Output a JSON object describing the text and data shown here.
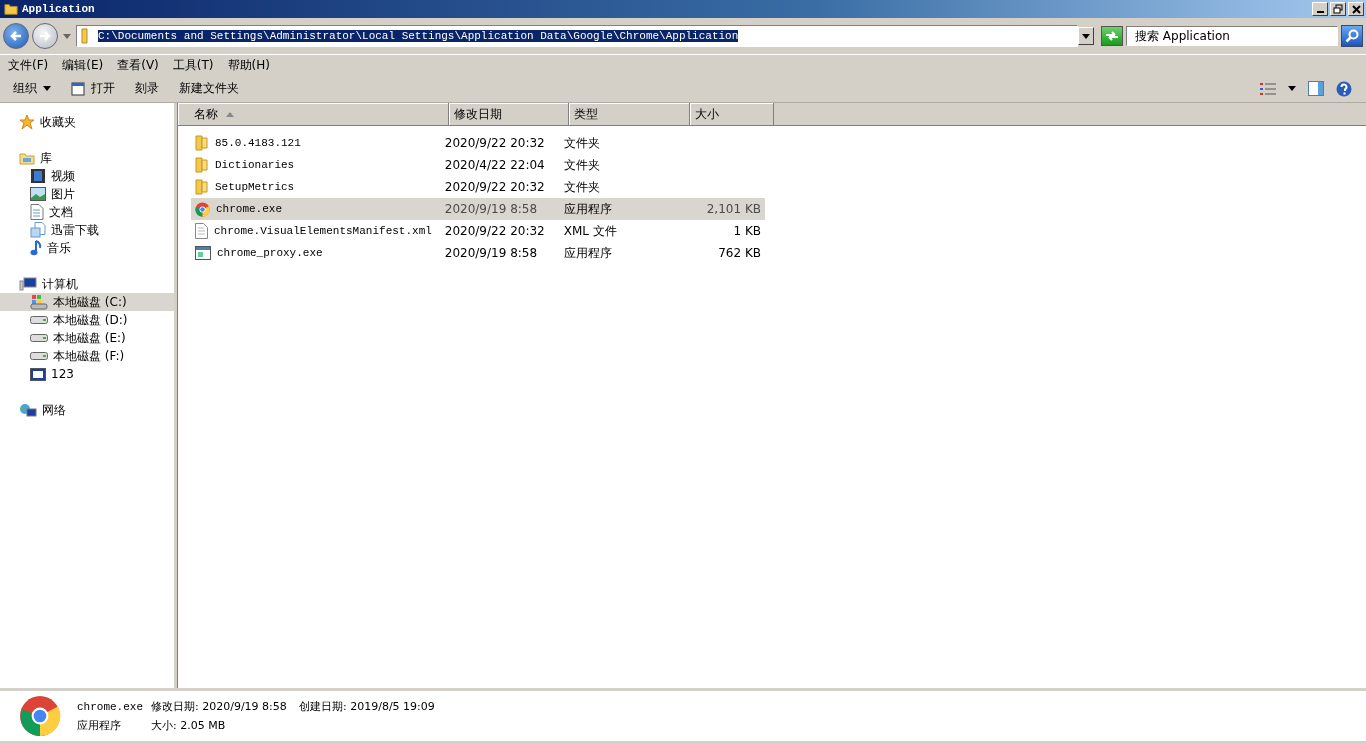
{
  "window": {
    "title": "Application"
  },
  "address": {
    "value": "C:\\Documents and Settings\\Administrator\\Local Settings\\Application Data\\Google\\Chrome\\Application"
  },
  "search": {
    "placeholder": "搜索 Application"
  },
  "menu": [
    "文件(F)",
    "编辑(E)",
    "查看(V)",
    "工具(T)",
    "帮助(H)"
  ],
  "toolbar": [
    {
      "label": "组织",
      "kind": "dropdown"
    },
    {
      "label": "打开",
      "kind": "open"
    },
    {
      "label": "刻录",
      "kind": "plain"
    },
    {
      "label": "新建文件夹",
      "kind": "plain"
    }
  ],
  "sidebar": {
    "groups": [
      {
        "label": "收藏夹",
        "kind": "star",
        "selected": false
      },
      {
        "label": "库",
        "kind": "library",
        "selected": false,
        "children": [
          {
            "label": "视频",
            "kind": "video",
            "selected": false
          },
          {
            "label": "图片",
            "kind": "picture",
            "selected": false
          },
          {
            "label": "文档",
            "kind": "document",
            "selected": false
          },
          {
            "label": "迅雷下载",
            "kind": "download",
            "selected": false
          },
          {
            "label": "音乐",
            "kind": "music",
            "selected": false
          }
        ]
      },
      {
        "label": "计算机",
        "kind": "computer",
        "selected": false,
        "children": [
          {
            "label": "本地磁盘 (C:)",
            "kind": "system-drive",
            "selected": true
          },
          {
            "label": "本地磁盘 (D:)",
            "kind": "drive",
            "selected": false
          },
          {
            "label": "本地磁盘 (E:)",
            "kind": "drive",
            "selected": false
          },
          {
            "label": "本地磁盘 (F:)",
            "kind": "drive",
            "selected": false
          },
          {
            "label": "123",
            "kind": "media",
            "selected": false
          }
        ]
      },
      {
        "label": "网络",
        "kind": "network",
        "selected": false
      }
    ]
  },
  "table": {
    "columns": [
      {
        "label": "名称",
        "sorted": true
      },
      {
        "label": "修改日期",
        "sorted": false
      },
      {
        "label": "类型",
        "sorted": false
      },
      {
        "label": "大小",
        "sorted": false
      }
    ],
    "rows": [
      {
        "name": "85.0.4183.121",
        "date": "2020/9/22 20:32",
        "type": "文件夹",
        "kind": "folder",
        "selected": false
      },
      {
        "name": "Dictionaries",
        "date": "2020/4/22 22:04",
        "type": "文件夹",
        "kind": "folder",
        "selected": false
      },
      {
        "name": "SetupMetrics",
        "date": "2020/9/22 20:32",
        "type": "文件夹",
        "kind": "folder",
        "selected": false
      },
      {
        "name": "chrome.exe",
        "date": "2020/9/19 8:58",
        "type": "应用程序",
        "size": "2,101 KB",
        "kind": "chrome",
        "selected": true
      },
      {
        "name": "chrome.VisualElementsManifest.xml",
        "date": "2020/9/22 20:32",
        "type": "XML 文件",
        "size": "1 KB",
        "kind": "document",
        "selected": false
      },
      {
        "name": "chrome_proxy.exe",
        "date": "2020/9/19 8:58",
        "type": "应用程序",
        "size": "762 KB",
        "kind": "program",
        "selected": false
      }
    ]
  },
  "details": {
    "name": "chrome.exe",
    "modified": "修改日期: 2020/9/19 8:58",
    "created": "创建日期: 2019/8/5 19:09",
    "type": "应用程序",
    "size": "大小: 2.05 MB"
  }
}
